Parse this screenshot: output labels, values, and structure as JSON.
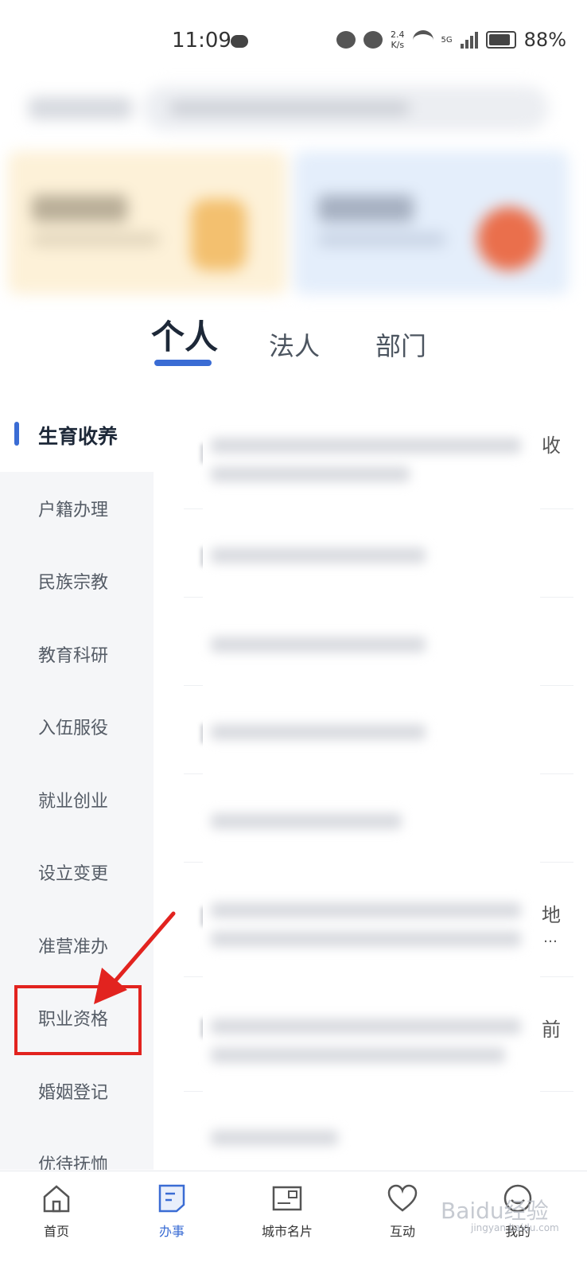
{
  "status_bar": {
    "time": "11:09",
    "speed_top": "2.4",
    "speed_bottom": "K/s",
    "network": "5G",
    "battery": "88%"
  },
  "tabs": [
    {
      "label": "个人",
      "active": true
    },
    {
      "label": "法人",
      "active": false
    },
    {
      "label": "部门",
      "active": false
    }
  ],
  "sidenav": {
    "items": [
      {
        "label": "生育收养",
        "active": true
      },
      {
        "label": "户籍办理"
      },
      {
        "label": "民族宗教"
      },
      {
        "label": "教育科研"
      },
      {
        "label": "入伍服役"
      },
      {
        "label": "就业创业"
      },
      {
        "label": "设立变更"
      },
      {
        "label": "准营准办"
      },
      {
        "label": "职业资格",
        "highlighted": true
      },
      {
        "label": "婚姻登记"
      },
      {
        "label": "优待抚恤"
      }
    ]
  },
  "list": {
    "visible_fragments": [
      "收",
      "地",
      "…",
      "前"
    ]
  },
  "bottom_nav": [
    {
      "label": "首页",
      "icon": "home-icon"
    },
    {
      "label": "办事",
      "icon": "document-icon",
      "active": true
    },
    {
      "label": "城市名片",
      "icon": "postcard-icon"
    },
    {
      "label": "互动",
      "icon": "heart-icon"
    },
    {
      "label": "我的",
      "icon": "profile-icon"
    }
  ],
  "watermark": {
    "text": "Baidu经验",
    "sub": "jingyan.baidu.com"
  },
  "colors": {
    "accent": "#3a6cd4",
    "annotation": "#e2231f"
  }
}
